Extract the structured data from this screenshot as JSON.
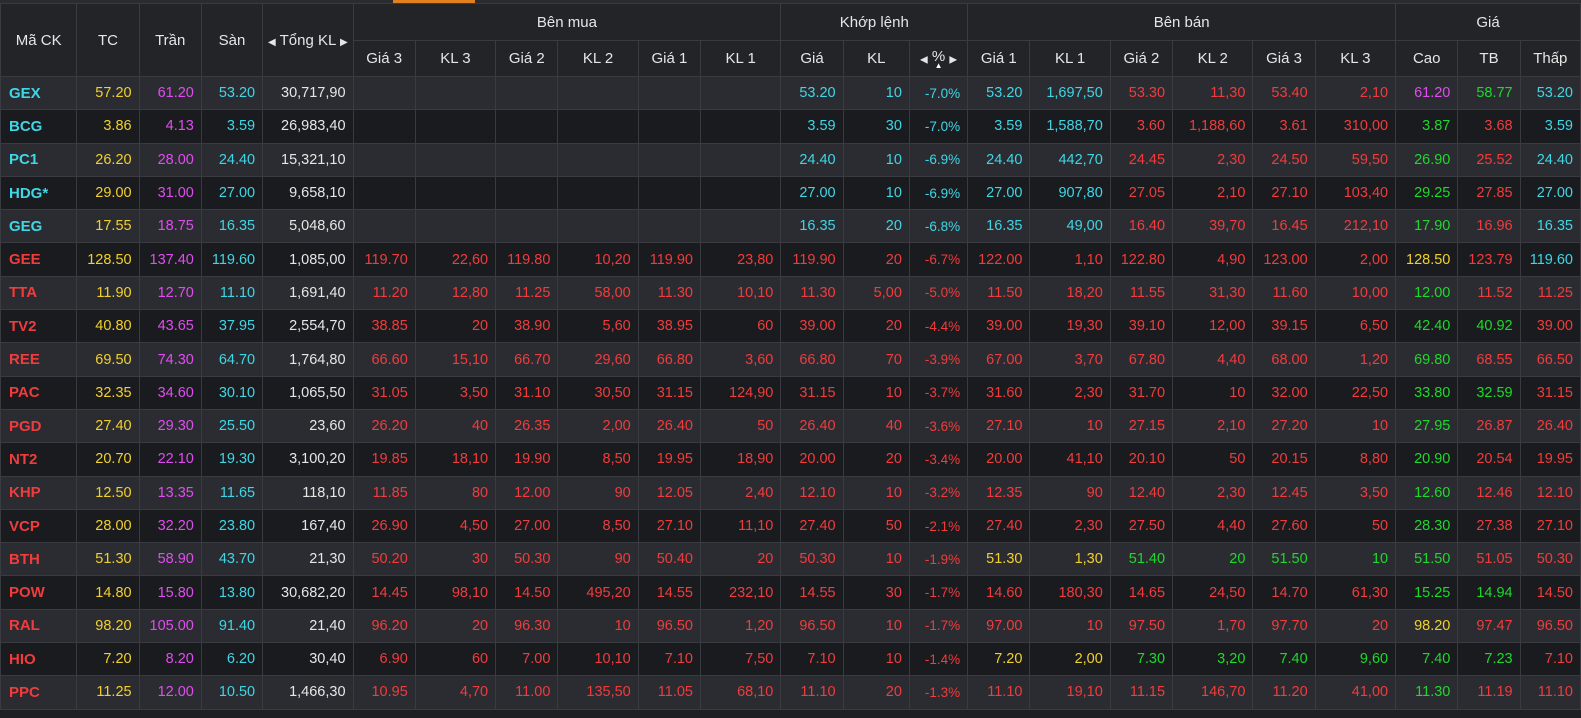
{
  "colors": {
    "ref": "#f2d02c",
    "ceil": "#e14cf0",
    "floor": "#3fd6e6",
    "up": "#1fd82c",
    "down": "#f03c3c",
    "white": "#e6e6e6",
    "accent": "#e0801f"
  },
  "header": {
    "symbol": "Mã CK",
    "ref": "TC",
    "ceil": "Trần",
    "floor": "Sàn",
    "total_vol": "Tổng KL",
    "groups": {
      "buy": "Bên mua",
      "match": "Khớp lệnh",
      "sell": "Bên bán",
      "price": "Giá"
    },
    "buy_cols": [
      "Giá 3",
      "KL 3",
      "Giá 2",
      "KL 2",
      "Giá 1",
      "KL 1"
    ],
    "match_cols": [
      "Giá",
      "KL",
      "%"
    ],
    "sell_cols": [
      "Giá 1",
      "KL 1",
      "Giá 2",
      "KL 2",
      "Giá 3",
      "KL 3"
    ],
    "price_cols": [
      "Cao",
      "TB",
      "Thấp"
    ]
  },
  "rows": [
    {
      "sym": "GEX",
      "tc": "57.20",
      "tran": "61.20",
      "san": "53.20",
      "vol": "30,717,90",
      "buy": [
        "",
        "",
        "",
        "",
        "",
        ""
      ],
      "match": [
        "53.20",
        "10",
        "-7.0%"
      ],
      "sell": [
        "53.20",
        "1,697,50",
        "53.30",
        "11,30",
        "53.40",
        "2,10"
      ],
      "hl": [
        "61.20",
        "58.77",
        "53.20"
      ]
    },
    {
      "sym": "BCG",
      "tc": "3.86",
      "tran": "4.13",
      "san": "3.59",
      "vol": "26,983,40",
      "buy": [
        "",
        "",
        "",
        "",
        "",
        ""
      ],
      "match": [
        "3.59",
        "30",
        "-7.0%"
      ],
      "sell": [
        "3.59",
        "1,588,70",
        "3.60",
        "1,188,60",
        "3.61",
        "310,00"
      ],
      "hl": [
        "3.87",
        "3.68",
        "3.59"
      ]
    },
    {
      "sym": "PC1",
      "tc": "26.20",
      "tran": "28.00",
      "san": "24.40",
      "vol": "15,321,10",
      "buy": [
        "",
        "",
        "",
        "",
        "",
        ""
      ],
      "match": [
        "24.40",
        "10",
        "-6.9%"
      ],
      "sell": [
        "24.40",
        "442,70",
        "24.45",
        "2,30",
        "24.50",
        "59,50"
      ],
      "hl": [
        "26.90",
        "25.52",
        "24.40"
      ]
    },
    {
      "sym": "HDG*",
      "tc": "29.00",
      "tran": "31.00",
      "san": "27.00",
      "vol": "9,658,10",
      "buy": [
        "",
        "",
        "",
        "",
        "",
        ""
      ],
      "match": [
        "27.00",
        "10",
        "-6.9%"
      ],
      "sell": [
        "27.00",
        "907,80",
        "27.05",
        "2,10",
        "27.10",
        "103,40"
      ],
      "hl": [
        "29.25",
        "27.85",
        "27.00"
      ]
    },
    {
      "sym": "GEG",
      "tc": "17.55",
      "tran": "18.75",
      "san": "16.35",
      "vol": "5,048,60",
      "buy": [
        "",
        "",
        "",
        "",
        "",
        ""
      ],
      "match": [
        "16.35",
        "20",
        "-6.8%"
      ],
      "sell": [
        "16.35",
        "49,00",
        "16.40",
        "39,70",
        "16.45",
        "212,10"
      ],
      "hl": [
        "17.90",
        "16.96",
        "16.35"
      ]
    },
    {
      "sym": "GEE",
      "tc": "128.50",
      "tran": "137.40",
      "san": "119.60",
      "vol": "1,085,00",
      "buy": [
        "119.70",
        "22,60",
        "119.80",
        "10,20",
        "119.90",
        "23,80"
      ],
      "match": [
        "119.90",
        "20",
        "-6.7%"
      ],
      "sell": [
        "122.00",
        "1,10",
        "122.80",
        "4,90",
        "123.00",
        "2,00"
      ],
      "hl": [
        "128.50",
        "123.79",
        "119.60"
      ]
    },
    {
      "sym": "TTA",
      "tc": "11.90",
      "tran": "12.70",
      "san": "11.10",
      "vol": "1,691,40",
      "buy": [
        "11.20",
        "12,80",
        "11.25",
        "58,00",
        "11.30",
        "10,10"
      ],
      "match": [
        "11.30",
        "5,00",
        "-5.0%"
      ],
      "sell": [
        "11.50",
        "18,20",
        "11.55",
        "31,30",
        "11.60",
        "10,00"
      ],
      "hl": [
        "12.00",
        "11.52",
        "11.25"
      ]
    },
    {
      "sym": "TV2",
      "tc": "40.80",
      "tran": "43.65",
      "san": "37.95",
      "vol": "2,554,70",
      "buy": [
        "38.85",
        "20",
        "38.90",
        "5,60",
        "38.95",
        "60"
      ],
      "match": [
        "39.00",
        "20",
        "-4.4%"
      ],
      "sell": [
        "39.00",
        "19,30",
        "39.10",
        "12,00",
        "39.15",
        "6,50"
      ],
      "hl": [
        "42.40",
        "40.92",
        "39.00"
      ]
    },
    {
      "sym": "REE",
      "tc": "69.50",
      "tran": "74.30",
      "san": "64.70",
      "vol": "1,764,80",
      "buy": [
        "66.60",
        "15,10",
        "66.70",
        "29,60",
        "66.80",
        "3,60"
      ],
      "match": [
        "66.80",
        "70",
        "-3.9%"
      ],
      "sell": [
        "67.00",
        "3,70",
        "67.80",
        "4,40",
        "68.00",
        "1,20"
      ],
      "hl": [
        "69.80",
        "68.55",
        "66.50"
      ]
    },
    {
      "sym": "PAC",
      "tc": "32.35",
      "tran": "34.60",
      "san": "30.10",
      "vol": "1,065,50",
      "buy": [
        "31.05",
        "3,50",
        "31.10",
        "30,50",
        "31.15",
        "124,90"
      ],
      "match": [
        "31.15",
        "10",
        "-3.7%"
      ],
      "sell": [
        "31.60",
        "2,30",
        "31.70",
        "10",
        "32.00",
        "22,50"
      ],
      "hl": [
        "33.80",
        "32.59",
        "31.15"
      ]
    },
    {
      "sym": "PGD",
      "tc": "27.40",
      "tran": "29.30",
      "san": "25.50",
      "vol": "23,60",
      "buy": [
        "26.20",
        "40",
        "26.35",
        "2,00",
        "26.40",
        "50"
      ],
      "match": [
        "26.40",
        "40",
        "-3.6%"
      ],
      "sell": [
        "27.10",
        "10",
        "27.15",
        "2,10",
        "27.20",
        "10"
      ],
      "hl": [
        "27.95",
        "26.87",
        "26.40"
      ]
    },
    {
      "sym": "NT2",
      "tc": "20.70",
      "tran": "22.10",
      "san": "19.30",
      "vol": "3,100,20",
      "buy": [
        "19.85",
        "18,10",
        "19.90",
        "8,50",
        "19.95",
        "18,90"
      ],
      "match": [
        "20.00",
        "20",
        "-3.4%"
      ],
      "sell": [
        "20.00",
        "41,10",
        "20.10",
        "50",
        "20.15",
        "8,80"
      ],
      "hl": [
        "20.90",
        "20.54",
        "19.95"
      ]
    },
    {
      "sym": "KHP",
      "tc": "12.50",
      "tran": "13.35",
      "san": "11.65",
      "vol": "118,10",
      "buy": [
        "11.85",
        "80",
        "12.00",
        "90",
        "12.05",
        "2,40"
      ],
      "match": [
        "12.10",
        "10",
        "-3.2%"
      ],
      "sell": [
        "12.35",
        "90",
        "12.40",
        "2,30",
        "12.45",
        "3,50"
      ],
      "hl": [
        "12.60",
        "12.46",
        "12.10"
      ]
    },
    {
      "sym": "VCP",
      "tc": "28.00",
      "tran": "32.20",
      "san": "23.80",
      "vol": "167,40",
      "buy": [
        "26.90",
        "4,50",
        "27.00",
        "8,50",
        "27.10",
        "11,10"
      ],
      "match": [
        "27.40",
        "50",
        "-2.1%"
      ],
      "sell": [
        "27.40",
        "2,30",
        "27.50",
        "4,40",
        "27.60",
        "50"
      ],
      "hl": [
        "28.30",
        "27.38",
        "27.10"
      ]
    },
    {
      "sym": "BTH",
      "tc": "51.30",
      "tran": "58.90",
      "san": "43.70",
      "vol": "21,30",
      "buy": [
        "50.20",
        "30",
        "50.30",
        "90",
        "50.40",
        "20"
      ],
      "match": [
        "50.30",
        "10",
        "-1.9%"
      ],
      "sell": [
        "51.30",
        "1,30",
        "51.40",
        "20",
        "51.50",
        "10"
      ],
      "hl": [
        "51.50",
        "51.05",
        "50.30"
      ]
    },
    {
      "sym": "POW",
      "tc": "14.80",
      "tran": "15.80",
      "san": "13.80",
      "vol": "30,682,20",
      "buy": [
        "14.45",
        "98,10",
        "14.50",
        "495,20",
        "14.55",
        "232,10"
      ],
      "match": [
        "14.55",
        "30",
        "-1.7%"
      ],
      "sell": [
        "14.60",
        "180,30",
        "14.65",
        "24,50",
        "14.70",
        "61,30"
      ],
      "hl": [
        "15.25",
        "14.94",
        "14.50"
      ]
    },
    {
      "sym": "RAL",
      "tc": "98.20",
      "tran": "105.00",
      "san": "91.40",
      "vol": "21,40",
      "buy": [
        "96.20",
        "20",
        "96.30",
        "10",
        "96.50",
        "1,20"
      ],
      "match": [
        "96.50",
        "10",
        "-1.7%"
      ],
      "sell": [
        "97.00",
        "10",
        "97.50",
        "1,70",
        "97.70",
        "20"
      ],
      "hl": [
        "98.20",
        "97.47",
        "96.50"
      ]
    },
    {
      "sym": "HIO",
      "tc": "7.20",
      "tran": "8.20",
      "san": "6.20",
      "vol": "30,40",
      "buy": [
        "6.90",
        "60",
        "7.00",
        "10,10",
        "7.10",
        "7,50"
      ],
      "match": [
        "7.10",
        "10",
        "-1.4%"
      ],
      "sell": [
        "7.20",
        "2,00",
        "7.30",
        "3,20",
        "7.40",
        "9,60"
      ],
      "hl": [
        "7.40",
        "7.23",
        "7.10"
      ]
    },
    {
      "sym": "PPC",
      "tc": "11.25",
      "tran": "12.00",
      "san": "10.50",
      "vol": "1,466,30",
      "buy": [
        "10.95",
        "4,70",
        "11.00",
        "135,50",
        "11.05",
        "68,10"
      ],
      "match": [
        "11.10",
        "20",
        "-1.3%"
      ],
      "sell": [
        "11.10",
        "19,10",
        "11.15",
        "146,70",
        "11.20",
        "41,00"
      ],
      "hl": [
        "11.30",
        "11.19",
        "11.10"
      ]
    }
  ]
}
